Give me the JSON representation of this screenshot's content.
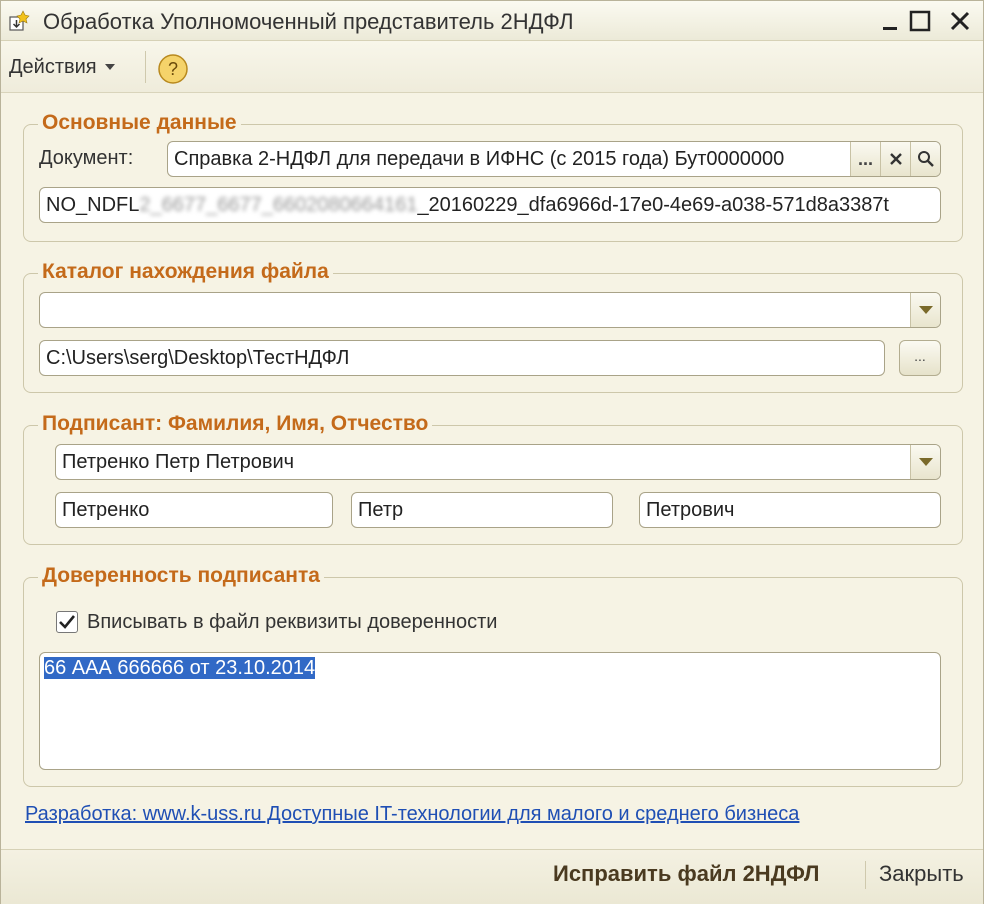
{
  "window": {
    "title": "Обработка  Уполномоченный представитель 2НДФЛ"
  },
  "toolbar": {
    "actions_label": "Действия",
    "help_label": "?"
  },
  "main_data": {
    "group_title": "Основные данные",
    "document_label": "Документ:",
    "document_value": "Справка 2-НДФЛ для передачи в ИФНС (с 2015 года) Бут0000000",
    "document_select_button": "...",
    "file_name_prefix": "NO_NDFL",
    "file_name_blurred": "2_6677_6677_6602080664161",
    "file_name_suffix": "_20160229_dfa6966d-17e0-4e69-a038-571d8a3387t"
  },
  "catalog": {
    "group_title": "Каталог нахождения файла",
    "dropdown_value": "",
    "path_value": "C:\\Users\\serg\\Desktop\\ТестНДФЛ",
    "browse_button": "..."
  },
  "signer": {
    "group_title": "Подписант: Фамилия, Имя, Отчество",
    "full_name": "Петренко Петр Петрович",
    "last_name": "Петренко",
    "first_name": "Петр",
    "middle_name": "Петрович"
  },
  "poa": {
    "group_title": "Доверенность подписанта",
    "checkbox_label": "Вписывать в файл реквизиты доверенности",
    "checkbox_checked": true,
    "details_text": "66 ААА 666666 от 23.10.2014"
  },
  "footer": {
    "link_text": "Разработка: www.k-uss.ru Доступные IT-технологии для малого и среднего бизнеса",
    "fix_button": "Исправить файл 2НДФЛ",
    "close_button": "Закрыть"
  },
  "colors": {
    "group_title": "#c46a1a",
    "link": "#1f4fb4",
    "selection": "#3169c6",
    "window_bg": "#f6f3e4"
  }
}
